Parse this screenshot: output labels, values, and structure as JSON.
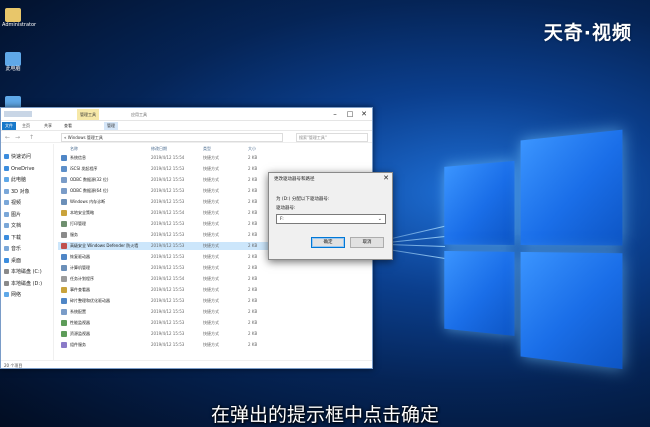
{
  "brand": "天奇·视频",
  "subtitle": "在弹出的提示框中点击确定",
  "desktop_icons": [
    {
      "label": "Administrator"
    },
    {
      "label": "此电脑"
    },
    {
      "label": "网络"
    }
  ],
  "explorer": {
    "context_tab": "管理工具",
    "context_tab2": "应用工具",
    "ribbon_tabs": [
      "文件",
      "主页",
      "共享",
      "查看",
      "管理"
    ],
    "nav_back": "←",
    "nav_forward": "→",
    "nav_up": "↑",
    "path": "« Windows 管理工具",
    "search_placeholder": "搜索\"管理工具\"",
    "nav_items": [
      "快速访问",
      "OneDrive",
      "此电脑",
      "3D 对象",
      "视频",
      "图片",
      "文档",
      "下载",
      "音乐",
      "桌面",
      "本地磁盘 (C:)",
      "本地磁盘 (D:)",
      "网络"
    ],
    "columns": {
      "name": "名称",
      "date": "修改日期",
      "type": "类型",
      "size": "大小"
    },
    "files": [
      {
        "name": "系统信息",
        "date": "2019/4/12 15:54",
        "type": "快捷方式",
        "size": "2 KB",
        "color": "#4f86c6"
      },
      {
        "name": "iSCSI 发起程序",
        "date": "2019/4/12 15:53",
        "type": "快捷方式",
        "size": "2 KB",
        "color": "#5d8fc9"
      },
      {
        "name": "ODBC 数据源(32 位)",
        "date": "2019/4/12 15:53",
        "type": "快捷方式",
        "size": "2 KB",
        "color": "#7a9cc8"
      },
      {
        "name": "ODBC 数据源(64 位)",
        "date": "2019/4/12 15:53",
        "type": "快捷方式",
        "size": "2 KB",
        "color": "#7a9cc8"
      },
      {
        "name": "Windows 内存诊断",
        "date": "2019/4/12 15:53",
        "type": "快捷方式",
        "size": "2 KB",
        "color": "#6b8fb8"
      },
      {
        "name": "本地安全策略",
        "date": "2019/4/12 15:54",
        "type": "快捷方式",
        "size": "2 KB",
        "color": "#c9a33b"
      },
      {
        "name": "打印管理",
        "date": "2019/4/12 15:53",
        "type": "快捷方式",
        "size": "2 KB",
        "color": "#6f8f6f"
      },
      {
        "name": "服务",
        "date": "2019/4/12 15:53",
        "type": "快捷方式",
        "size": "2 KB",
        "color": "#8a8a8a"
      },
      {
        "name": "高级安全 Windows Defender 防火墙",
        "date": "2019/4/12 15:53",
        "type": "快捷方式",
        "size": "2 KB",
        "color": "#c0504d"
      },
      {
        "name": "恢复驱动器",
        "date": "2019/4/12 15:53",
        "type": "快捷方式",
        "size": "2 KB",
        "color": "#4f86c6"
      },
      {
        "name": "计算机管理",
        "date": "2019/4/12 15:53",
        "type": "快捷方式",
        "size": "2 KB",
        "color": "#6b8fb8"
      },
      {
        "name": "任务计划程序",
        "date": "2019/4/12 15:54",
        "type": "快捷方式",
        "size": "2 KB",
        "color": "#9b9b9b"
      },
      {
        "name": "事件查看器",
        "date": "2019/4/12 15:53",
        "type": "快捷方式",
        "size": "2 KB",
        "color": "#c9a33b"
      },
      {
        "name": "碎片整理和优化驱动器",
        "date": "2019/4/12 15:53",
        "type": "快捷方式",
        "size": "2 KB",
        "color": "#4f86c6"
      },
      {
        "name": "系统配置",
        "date": "2019/4/12 15:53",
        "type": "快捷方式",
        "size": "2 KB",
        "color": "#7a9cc8"
      },
      {
        "name": "性能监视器",
        "date": "2019/4/12 15:53",
        "type": "快捷方式",
        "size": "2 KB",
        "color": "#5d9c59"
      },
      {
        "name": "资源监视器",
        "date": "2019/4/12 15:53",
        "type": "快捷方式",
        "size": "2 KB",
        "color": "#5d9c59"
      },
      {
        "name": "组件服务",
        "date": "2019/4/12 15:53",
        "type": "快捷方式",
        "size": "2 KB",
        "color": "#8a7ac8"
      }
    ],
    "selected_index": 8,
    "status": "20 个项目"
  },
  "dialog": {
    "title": "更改驱动器号和路径",
    "close": "✕",
    "prompt": "为 (D:) 分配以下驱动器号:",
    "label": "驱动器号:",
    "select_value": "F:",
    "ok_label": "确定",
    "cancel_label": "取消"
  }
}
